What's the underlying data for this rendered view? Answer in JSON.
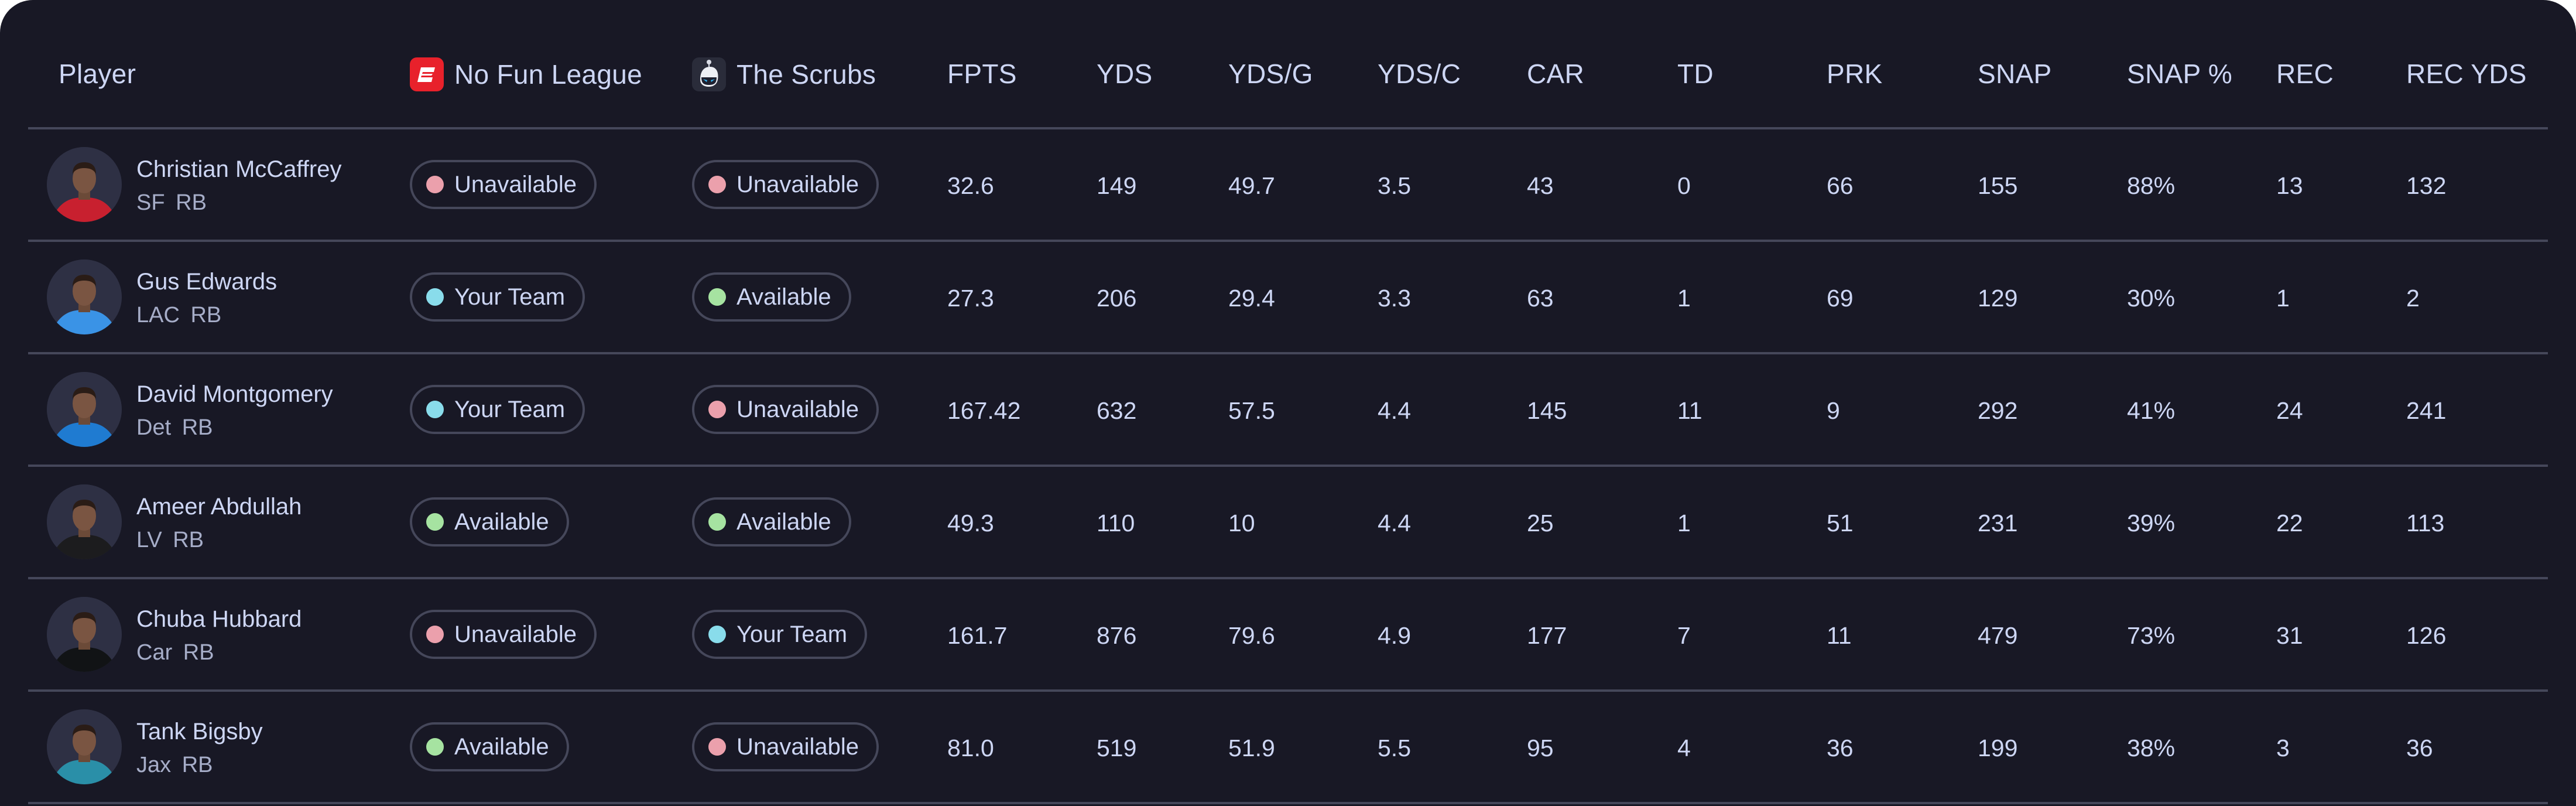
{
  "colors": {
    "background": "#181825",
    "border": "#45475a",
    "text": "#cdd6f4",
    "subtext": "#a6adc8",
    "status_unavailable": "#eba0ac",
    "status_available": "#a6e3a1",
    "status_your_team": "#89dceb",
    "espn_red": "#e8212b"
  },
  "header": {
    "player": "Player",
    "leagues": [
      {
        "name": "No Fun League",
        "icon": "espn-logo-icon"
      },
      {
        "name": "The Scrubs",
        "icon": "robot-logo-icon"
      }
    ],
    "stats": [
      "FPTS",
      "YDS",
      "YDS/G",
      "YDS/C",
      "CAR",
      "TD",
      "PRK",
      "SNAP",
      "SNAP %",
      "REC",
      "REC YDS"
    ]
  },
  "rows": [
    {
      "name": "Christian McCaffrey",
      "team": "SF",
      "pos": "RB",
      "jersey": "#c8202f",
      "status": [
        {
          "label": "Unavailable",
          "kind": "unavailable"
        },
        {
          "label": "Unavailable",
          "kind": "unavailable"
        }
      ],
      "stats": [
        "32.6",
        "149",
        "49.7",
        "3.5",
        "43",
        "0",
        "66",
        "155",
        "88%",
        "13",
        "132"
      ]
    },
    {
      "name": "Gus Edwards",
      "team": "LAC",
      "pos": "RB",
      "jersey": "#3a93e6",
      "status": [
        {
          "label": "Your Team",
          "kind": "your_team"
        },
        {
          "label": "Available",
          "kind": "available"
        }
      ],
      "stats": [
        "27.3",
        "206",
        "29.4",
        "3.3",
        "63",
        "1",
        "69",
        "129",
        "30%",
        "1",
        "2"
      ]
    },
    {
      "name": "David Montgomery",
      "team": "Det",
      "pos": "RB",
      "jersey": "#1f7bd1",
      "status": [
        {
          "label": "Your Team",
          "kind": "your_team"
        },
        {
          "label": "Unavailable",
          "kind": "unavailable"
        }
      ],
      "stats": [
        "167.42",
        "632",
        "57.5",
        "4.4",
        "145",
        "11",
        "9",
        "292",
        "41%",
        "24",
        "241"
      ]
    },
    {
      "name": "Ameer Abdullah",
      "team": "LV",
      "pos": "RB",
      "jersey": "#1c1c1e",
      "status": [
        {
          "label": "Available",
          "kind": "available"
        },
        {
          "label": "Available",
          "kind": "available"
        }
      ],
      "stats": [
        "49.3",
        "110",
        "10",
        "4.4",
        "25",
        "1",
        "51",
        "231",
        "39%",
        "22",
        "113"
      ]
    },
    {
      "name": "Chuba Hubbard",
      "team": "Car",
      "pos": "RB",
      "jersey": "#111315",
      "status": [
        {
          "label": "Unavailable",
          "kind": "unavailable"
        },
        {
          "label": "Your Team",
          "kind": "your_team"
        }
      ],
      "stats": [
        "161.7",
        "876",
        "79.6",
        "4.9",
        "177",
        "7",
        "11",
        "479",
        "73%",
        "31",
        "126"
      ]
    },
    {
      "name": "Tank Bigsby",
      "team": "Jax",
      "pos": "RB",
      "jersey": "#2a8fa8",
      "status": [
        {
          "label": "Available",
          "kind": "available"
        },
        {
          "label": "Unavailable",
          "kind": "unavailable"
        }
      ],
      "stats": [
        "81.0",
        "519",
        "51.9",
        "5.5",
        "95",
        "4",
        "36",
        "199",
        "38%",
        "3",
        "36"
      ]
    }
  ]
}
